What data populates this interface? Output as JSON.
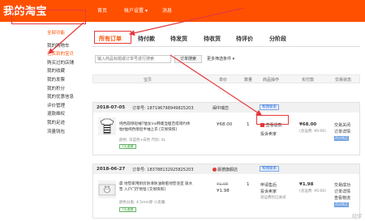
{
  "header": {
    "logo": "我的淘宝",
    "nav": [
      "首页",
      "帐户设置",
      "消息"
    ],
    "nav_caret": "▾"
  },
  "sidebar": {
    "items": [
      "全部功能",
      "我的购物车",
      "已买到的宝贝",
      "购买过的店铺",
      "我的收藏",
      "我的发票",
      "我的积分",
      "我的优惠信息",
      "评价管理",
      "退款维权",
      "我的足迹",
      "流量钱包"
    ],
    "active_index": 2
  },
  "tabs": {
    "items": [
      "所有订单",
      "待付款",
      "待发货",
      "待收货",
      "待评价",
      "分阶段"
    ],
    "active_index": 0
  },
  "search": {
    "placeholder": "输入商品标题或订单号进行搜索",
    "button": "订单搜索",
    "more": "更多筛选条件",
    "more_caret": "▾"
  },
  "table_headers": [
    "宝贝",
    "单价",
    "数量",
    "商品操作",
    "实付款",
    "交易状态"
  ],
  "orders": [
    {
      "date": "2018-07-05",
      "order_no": "订单号: 187196798949825203",
      "shop": "闽中瑞恋",
      "contact": "和我联系",
      "product": "纯色圆领短袖T恤女ins韩版显瘦百搭简约体恤t恤纯色情侣半袖上衣 [交易快照]",
      "attrs": "颜色: 深蓝色+白色  尺码: XL",
      "badge": "7天退换",
      "price": "¥68.00",
      "qty": "1",
      "ops": [
        "查看退款",
        "投诉卖家"
      ],
      "paid": "¥68.00",
      "paid_note": "(含运费: ¥0.00)",
      "status": [
        "交易关闭",
        "订单详情"
      ],
      "btn": "再次购买"
    },
    {
      "date": "2018-06-27",
      "order_no": "订单号: 183788132925825203",
      "shop": "晨德旗舰店",
      "contact": "和我联系",
      "product": "晨 地垫家用厨房防滑防油耐脏地垫浴室 吸水垫 入户门厅地毯 [交易快照]",
      "attrs": "颜色分类: 4.5mm厚 小恶魔",
      "badge": "7天退换",
      "price": "¥1.98",
      "price_old": "¥1.98",
      "qty": "1",
      "ops": [
        "申请售后",
        "投诉卖家",
        "退运费险已关闭"
      ],
      "paid": "¥1.98",
      "paid_note": "(含运费: ¥0.00)",
      "status": [
        "交易成功",
        "订单详情",
        "查看物流"
      ],
      "btn": "再次购买"
    }
  ],
  "watermark": "经验",
  "colors": {
    "brand": "#ff5000",
    "callout": "#e4393c"
  }
}
